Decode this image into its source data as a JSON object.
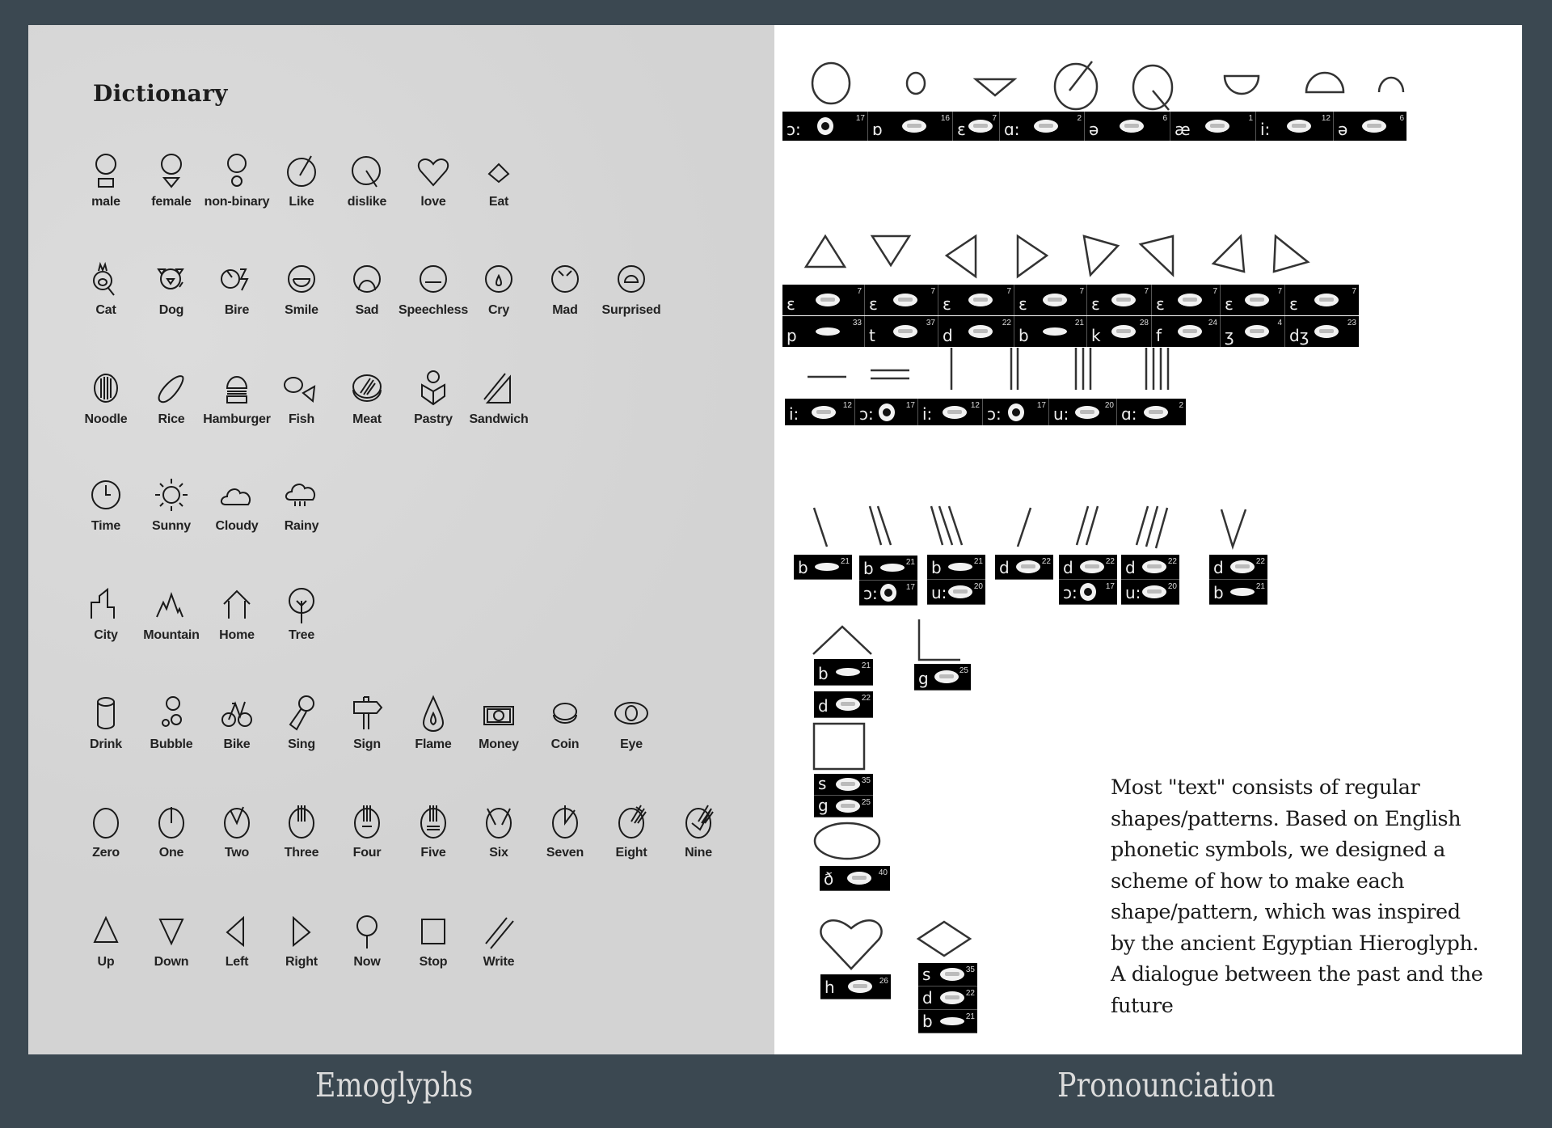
{
  "left_panel": {
    "title": "Dictionary",
    "rows": [
      [
        "male",
        "female",
        "non-binary",
        "Like",
        "dislike",
        "love",
        "Eat"
      ],
      [
        "Cat",
        "Dog",
        "Bire",
        "Smile",
        "Sad",
        "Speechless",
        "Cry",
        "Mad",
        "Surprised"
      ],
      [
        "Noodle",
        "Rice",
        "Hamburger",
        "Fish",
        "Meat",
        "Pastry",
        "Sandwich"
      ],
      [
        "Time",
        "Sunny",
        "Cloudy",
        "Rainy"
      ],
      [
        "City",
        "Mountain",
        "Home",
        "Tree"
      ],
      [
        "Drink",
        "Bubble",
        "Bike",
        "Sing",
        "Sign",
        "Flame",
        "Money",
        "Coin",
        "Eye"
      ],
      [
        "Zero",
        "One",
        "Two",
        "Three",
        "Four",
        "Five",
        "Six",
        "Seven",
        "Eight",
        "Nine"
      ],
      [
        "Up",
        "Down",
        "Left",
        "Right",
        "Now",
        "Stop",
        "Write"
      ]
    ]
  },
  "right_panel": {
    "vowel_strip": [
      {
        "symbol": "ɔ:",
        "number": "17"
      },
      {
        "symbol": "ɒ",
        "number": "16"
      },
      {
        "symbol": "ɛ",
        "number": "7"
      },
      {
        "symbol": "ɑ:",
        "number": "2"
      },
      {
        "symbol": "ə",
        "number": "6"
      },
      {
        "symbol": "æ",
        "number": "1"
      },
      {
        "symbol": "i:",
        "number": "12"
      },
      {
        "symbol": "ə",
        "number": "6"
      }
    ],
    "triangle_strip_top": [
      {
        "symbol": "ɛ",
        "number": "7"
      },
      {
        "symbol": "ɛ",
        "number": "7"
      },
      {
        "symbol": "ɛ",
        "number": "7"
      },
      {
        "symbol": "ɛ",
        "number": "7"
      },
      {
        "symbol": "ɛ",
        "number": "7"
      },
      {
        "symbol": "ɛ",
        "number": "7"
      },
      {
        "symbol": "ɛ",
        "number": "7"
      },
      {
        "symbol": "ɛ",
        "number": "7"
      }
    ],
    "triangle_strip_bottom": [
      {
        "symbol": "p",
        "number": "33"
      },
      {
        "symbol": "t",
        "number": "37"
      },
      {
        "symbol": "d",
        "number": "22"
      },
      {
        "symbol": "b",
        "number": "21"
      },
      {
        "symbol": "k",
        "number": "28"
      },
      {
        "symbol": "f",
        "number": "24"
      },
      {
        "symbol": "ʒ",
        "number": "4"
      },
      {
        "symbol": "dʒ",
        "number": "23"
      }
    ],
    "line_strip": [
      {
        "symbol": "i:",
        "number": "12"
      },
      {
        "symbol": "ɔ:",
        "number": "17"
      },
      {
        "symbol": "i:",
        "number": "12"
      },
      {
        "symbol": "ɔ:",
        "number": "17"
      },
      {
        "symbol": "u:",
        "number": "20"
      },
      {
        "symbol": "ɑ:",
        "number": "2"
      }
    ],
    "slash_groups": [
      [
        {
          "symbol": "b",
          "number": "21"
        }
      ],
      [
        {
          "symbol": "b",
          "number": "21"
        },
        {
          "symbol": "ɔ:",
          "number": "17"
        }
      ],
      [
        {
          "symbol": "b",
          "number": "21"
        },
        {
          "symbol": "u:",
          "number": "20"
        }
      ],
      [
        {
          "symbol": "d",
          "number": "22"
        }
      ],
      [
        {
          "symbol": "d",
          "number": "22"
        },
        {
          "symbol": "ɔ:",
          "number": "17"
        }
      ],
      [
        {
          "symbol": "d",
          "number": "22"
        },
        {
          "symbol": "u:",
          "number": "20"
        }
      ],
      [
        {
          "symbol": "d",
          "number": "22"
        },
        {
          "symbol": "b",
          "number": "21"
        }
      ]
    ],
    "roof_group": [
      {
        "symbol": "b",
        "number": "21"
      }
    ],
    "roof_group_2": [
      {
        "symbol": "d",
        "number": "22"
      }
    ],
    "corner_group": [
      {
        "symbol": "g",
        "number": "25"
      }
    ],
    "square_group": [
      {
        "symbol": "s",
        "number": "35"
      },
      {
        "symbol": "g",
        "number": "25"
      }
    ],
    "ellipse_group": [
      {
        "symbol": "ð",
        "number": "40"
      }
    ],
    "heart_group": [
      {
        "symbol": "h",
        "number": "26"
      }
    ],
    "diamond_group": [
      {
        "symbol": "s",
        "number": "35"
      },
      {
        "symbol": "d",
        "number": "22"
      },
      {
        "symbol": "b",
        "number": "21"
      }
    ],
    "description": "Most \"text\" consists of regular shapes/patterns. Based on English phonetic symbols, we designed a scheme of how to make each shape/pattern, which was inspired by the ancient Egyptian Hieroglyph. A dialogue between the past and the future"
  },
  "footer": {
    "left_label": "Emoglyphs",
    "right_label": "Pronounciation"
  },
  "colors": {
    "background": "#3b4851",
    "left_panel": "#d6d6d6",
    "right_panel": "#ffffff",
    "footer_text": "#dcdcdc"
  }
}
